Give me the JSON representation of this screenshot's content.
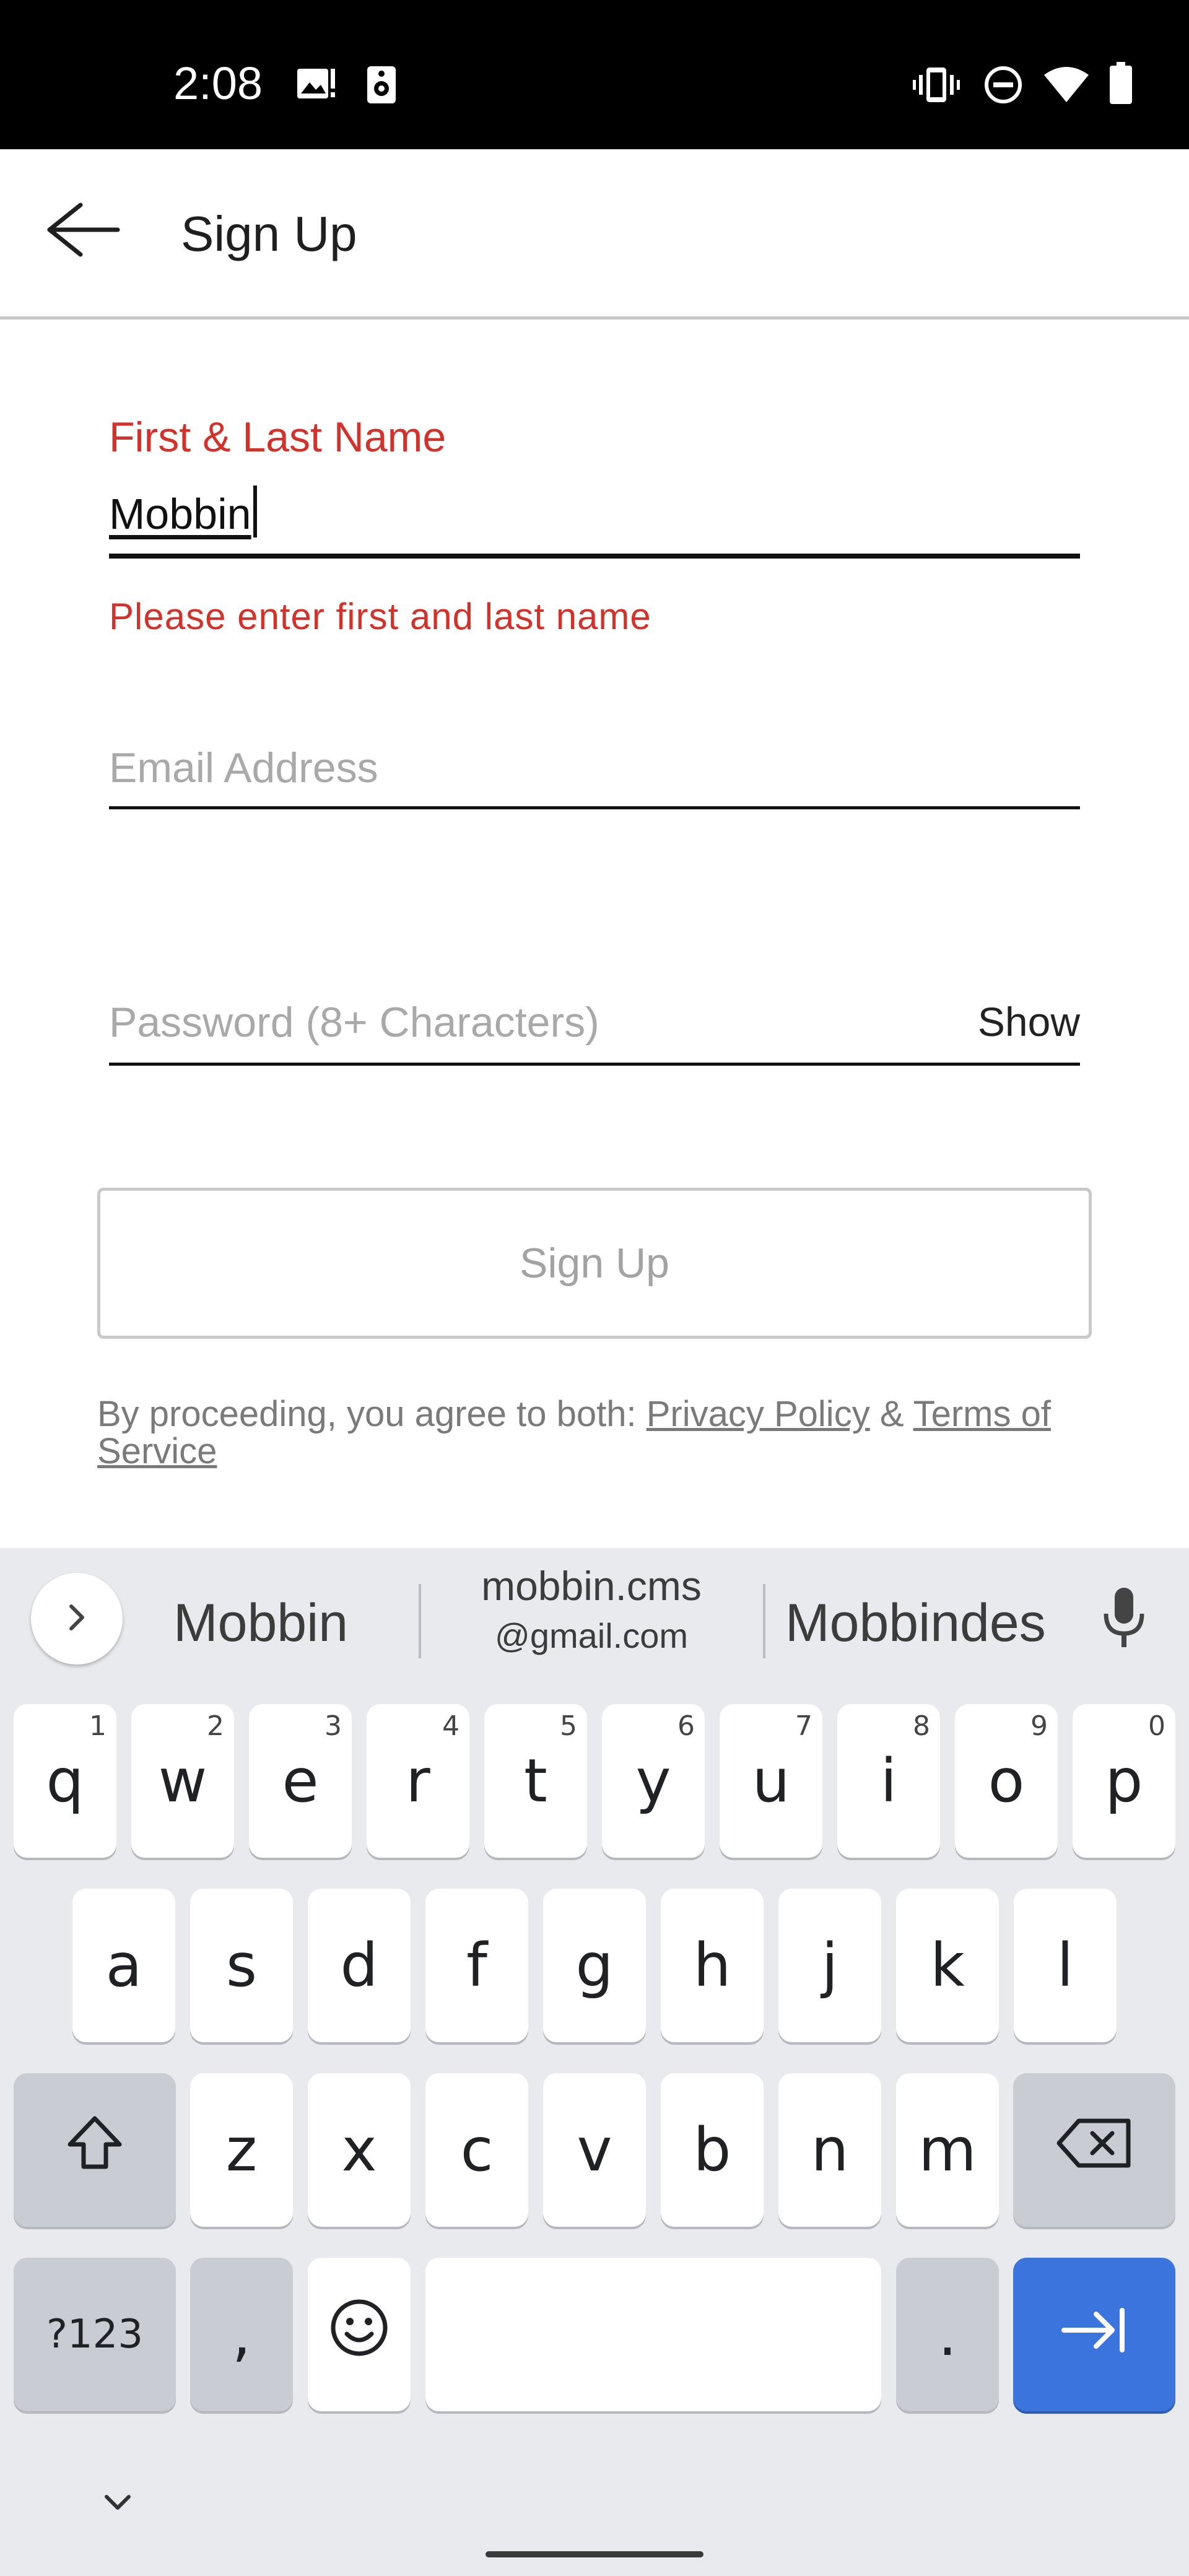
{
  "status_bar": {
    "time": "2:08",
    "icons": [
      "image-alert-icon",
      "speaker-icon",
      "vibrate-icon",
      "do-not-disturb-icon",
      "wifi-icon",
      "battery-icon"
    ]
  },
  "app_bar": {
    "back_icon": "arrow-left-icon",
    "title": "Sign Up"
  },
  "form": {
    "name_field": {
      "label": "First & Last Name",
      "value": "Mobbin",
      "error": "Please enter first and last name"
    },
    "email_field": {
      "placeholder": "Email Address",
      "value": ""
    },
    "password_field": {
      "placeholder": "Password (8+ Characters)",
      "value": "",
      "toggle_label": "Show"
    },
    "submit_label": "Sign Up",
    "legal": {
      "prefix": "By proceeding, you agree to both: ",
      "privacy_link": "Privacy Policy",
      "joiner": " & ",
      "terms_link": "Terms of Service"
    }
  },
  "keyboard": {
    "suggestions": {
      "left": "Mobbin",
      "middle_main": "mobbin.cms",
      "middle_sub": "@gmail.com",
      "right": "Mobbindes"
    },
    "row1": [
      {
        "key": "q",
        "hint": "1"
      },
      {
        "key": "w",
        "hint": "2"
      },
      {
        "key": "e",
        "hint": "3"
      },
      {
        "key": "r",
        "hint": "4"
      },
      {
        "key": "t",
        "hint": "5"
      },
      {
        "key": "y",
        "hint": "6"
      },
      {
        "key": "u",
        "hint": "7"
      },
      {
        "key": "i",
        "hint": "8"
      },
      {
        "key": "o",
        "hint": "9"
      },
      {
        "key": "p",
        "hint": "0"
      }
    ],
    "row2": [
      "a",
      "s",
      "d",
      "f",
      "g",
      "h",
      "j",
      "k",
      "l"
    ],
    "row3": [
      "z",
      "x",
      "c",
      "v",
      "b",
      "n",
      "m"
    ],
    "symbols_label": "?123",
    "comma": ",",
    "period": ".",
    "colors": {
      "background": "#e9eaee",
      "key": "#ffffff",
      "function_key": "#c9ccd2",
      "action_key": "#3b74dc"
    }
  },
  "colors": {
    "error": "#d3322a",
    "placeholder": "#a9a9a9",
    "text": "#111111"
  }
}
